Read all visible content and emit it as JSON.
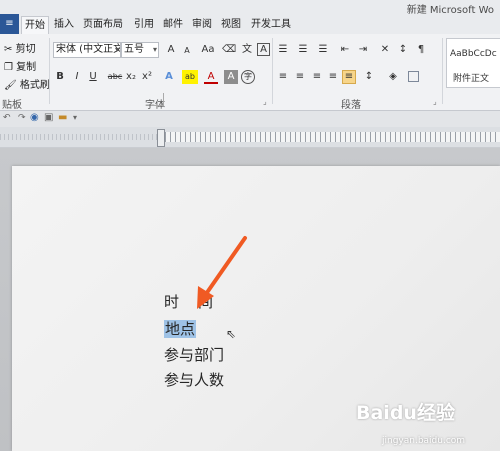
{
  "window": {
    "title": "新建 Microsoft Wo"
  },
  "tabs": [
    {
      "label": "开始",
      "active": true
    },
    {
      "label": "插入"
    },
    {
      "label": "页面布局"
    },
    {
      "label": "引用"
    },
    {
      "label": "邮件"
    },
    {
      "label": "审阅"
    },
    {
      "label": "视图"
    },
    {
      "label": "开发工具"
    }
  ],
  "clipboard": {
    "cut": "剪切",
    "copy": "复制",
    "format_painter": "格式刷",
    "group_label": "贴板"
  },
  "font": {
    "name": "宋体 (中文正文",
    "size": "五号",
    "group_label": "字体",
    "grow": "A",
    "shrink": "A",
    "case": "Aa",
    "clear_format": "A",
    "bold": "B",
    "italic": "I",
    "underline": "U",
    "strikethrough": "abc",
    "subscript": "x₂",
    "superscript": "x²",
    "text_effect": "A",
    "highlight": "ab",
    "font_color": "A",
    "char_shading": "A",
    "enclose": "字"
  },
  "paragraph": {
    "group_label": "段落"
  },
  "styles": {
    "preview": "AaBbCcDc",
    "name": "附件正文"
  },
  "document": {
    "lines": [
      "时　间",
      "地点",
      "参与部门",
      "参与人数"
    ],
    "selected_line": 1
  },
  "watermark": {
    "logo": "Baidu经验",
    "url": "jingyan.baidu.com"
  },
  "colors": {
    "file_tab": "#2b5797",
    "selection": "#9ec2e6",
    "arrow": "#f05a23",
    "active_align": "#f7d58a"
  }
}
